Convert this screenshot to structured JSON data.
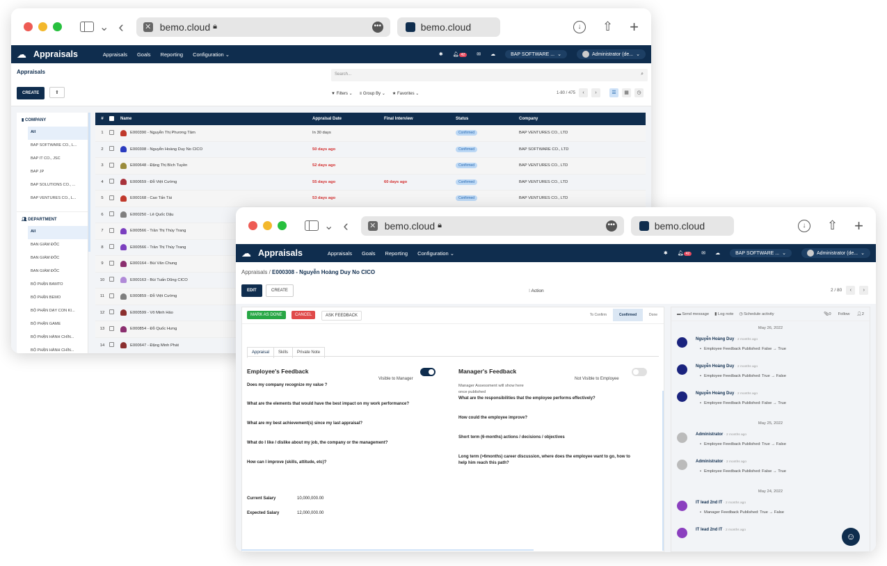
{
  "browser": {
    "url": "bemo.cloud",
    "tab_title": "bemo.cloud"
  },
  "navbar": {
    "app_title": "Appraisals",
    "menu": [
      "Appraisals",
      "Goals",
      "Reporting",
      "Configuration ⌄"
    ],
    "notification_count": "42",
    "company_switch": "BAP SOFTWARE ...",
    "user": "Administrator (de..."
  },
  "list_view": {
    "title": "Appraisals",
    "search_placeholder": "Search...",
    "create_label": "CREATE",
    "filters_label": "Filters",
    "groupby_label": "Group By",
    "favorites_label": "Favorites",
    "pager": "1-80 / 475",
    "company_header": "COMPANY",
    "companies": [
      "All",
      "BAP SOFTWARE CO., L...",
      "BAP IT CO., JSC",
      "BAP JP",
      "BAP SOLUTIONS CO., ...",
      "BAP VENTURES CO., L..."
    ],
    "department_header": "DEPARTMENT",
    "departments": [
      "All",
      "BAN GIÁM ĐỐC",
      "BAN GIÁM ĐỐC",
      "BAN GIÁM ĐỐC",
      "BỘ PHẬN BAMTO",
      "BỘ PHẬN BEMO",
      "BỘ PHẬN DẠY CON KI...",
      "BỘ PHẬN GAME",
      "BỘ PHẬN HÀNH CHÍN...",
      "BỘ PHẬN HÀNH CHÍN..."
    ],
    "columns": [
      "#",
      "Name",
      "Appraisal Date",
      "Final Interview",
      "Status",
      "Company"
    ],
    "rows": [
      {
        "n": "1",
        "name": "E000390 - Nguyễn Thị Phương Tâm",
        "date": "In 30 days",
        "date_red": false,
        "interview": "",
        "status": "Confirmed",
        "company": "BAP VENTURES CO., LTD",
        "av": "#c0392b"
      },
      {
        "n": "2",
        "name": "E000308 - Nguyễn Hoàng Duy No CICO",
        "date": "50 days ago",
        "date_red": true,
        "interview": "",
        "status": "Confirmed",
        "company": "BAP SOFTWARE CO., LTD",
        "av": "#2a3bbf"
      },
      {
        "n": "3",
        "name": "E000648 - Đặng Thị Bích Tuyền",
        "date": "52 days ago",
        "date_red": true,
        "interview": "",
        "status": "Confirmed",
        "company": "BAP VENTURES CO., LTD",
        "av": "#9a8b3b"
      },
      {
        "n": "4",
        "name": "E000659 - Đỗ Việt Cường",
        "date": "55 days ago",
        "date_red": true,
        "interview": "60 days ago",
        "status": "Confirmed",
        "company": "BAP VENTURES CO., LTD",
        "av": "#a8323b"
      },
      {
        "n": "5",
        "name": "E000168 - Cao Tấn Tài",
        "date": "53 days ago",
        "date_red": true,
        "interview": "",
        "status": "Confirmed",
        "company": "BAP VENTURES CO., LTD",
        "av": "#c0392b"
      },
      {
        "n": "6",
        "name": "E000250 - Lê Quốc Dậu",
        "date": "",
        "date_red": false,
        "interview": "",
        "status": "",
        "company": "",
        "av": "#7f7f7f"
      },
      {
        "n": "7",
        "name": "E000566 - Trần Thị Thúy Trang",
        "date": "",
        "date_red": false,
        "interview": "",
        "status": "",
        "company": "",
        "av": "#7b3fbf"
      },
      {
        "n": "8",
        "name": "E000566 - Trần Thị Thúy Trang",
        "date": "",
        "date_red": false,
        "interview": "",
        "status": "",
        "company": "",
        "av": "#7b3fbf"
      },
      {
        "n": "9",
        "name": "E000164 - Bùi Văn Chung",
        "date": "",
        "date_red": false,
        "interview": "",
        "status": "",
        "company": "",
        "av": "#8b2f6f"
      },
      {
        "n": "10",
        "name": "E000163 - Bùi Tuấn Dũng CICO",
        "date": "",
        "date_red": false,
        "interview": "",
        "status": "",
        "company": "",
        "av": "#b08ad8"
      },
      {
        "n": "11",
        "name": "E000859 - Đỗ Việt Cường",
        "date": "",
        "date_red": false,
        "interview": "",
        "status": "",
        "company": "",
        "av": "#7f7f7f"
      },
      {
        "n": "12",
        "name": "E000599 - Võ Minh Hảo",
        "date": "",
        "date_red": false,
        "interview": "",
        "status": "",
        "company": "",
        "av": "#8b2f2f"
      },
      {
        "n": "13",
        "name": "E000854 - Đỗ Quốc Hưng",
        "date": "",
        "date_red": false,
        "interview": "",
        "status": "",
        "company": "",
        "av": "#8b2f6f"
      },
      {
        "n": "14",
        "name": "E000647 - Đặng Minh Phát",
        "date": "",
        "date_red": false,
        "interview": "",
        "status": "",
        "company": "",
        "av": "#8b2f2f"
      }
    ]
  },
  "form_view": {
    "breadcrumb_parent": "Appraisals",
    "breadcrumb_current": "E000308 - Nguyễn Hoàng Duy No CICO",
    "edit_label": "EDIT",
    "create_label": "CREATE",
    "action_label": "Action",
    "pager": "2 / 80",
    "mark_done": "MARK AS DONE",
    "cancel": "CANCEL",
    "ask_feedback": "ASK FEEDBACK",
    "stages": [
      "To Confirm",
      "Confirmed",
      "Done"
    ],
    "tabs": [
      "Appraisal",
      "Skills",
      "Private Note"
    ],
    "employee_feedback": "Employee's Feedback",
    "visible_to_manager": "Visible to Manager",
    "manager_feedback": "Manager's Feedback",
    "not_visible": "Not Visible to Employee",
    "manager_note_1": "Manager Assessment will show here",
    "manager_note_2": "once published",
    "employee_questions": [
      "Does my company recognize my value ?",
      "What are the elements that would have the best impact on my work performance?",
      "What are my best achievement(s) since my last appraisal?",
      "What do I like / dislike about my job, the company or the management?",
      "How can I improve (skills, attitude, etc)?"
    ],
    "manager_questions": [
      "What are the responsibilities that the employee performs effectively?",
      "How could the employee improve?",
      "Short term (6-months) actions / decisions / objectives",
      "Long term (>6months) career discussion, where does the employee want to go, how to",
      "help him reach this path?"
    ],
    "current_salary_label": "Current Salary",
    "current_salary": "10,000,000.00",
    "expected_salary_label": "Expected Salary",
    "expected_salary": "12,000,000.00"
  },
  "chatter": {
    "send_message": "Send message",
    "log_note": "Log note",
    "schedule": "Schedule activity",
    "attachments": "0",
    "follow": "Follow",
    "followers": "2",
    "days": [
      "May 26, 2022",
      "May 25, 2022",
      "May 24, 2022"
    ],
    "messages": [
      {
        "author": "Nguyễn Hoàng Duy",
        "ago": "· 2 months ago",
        "body": "Employee Feedback Published: False → True"
      },
      {
        "author": "Nguyễn Hoàng Duy",
        "ago": "· 2 months ago",
        "body": "Employee Feedback Published: True → False"
      },
      {
        "author": "Nguyễn Hoàng Duy",
        "ago": "· 2 months ago",
        "body": "Employee Feedback Published: False → True"
      },
      {
        "author": "Administrator",
        "ago": "· 2 months ago",
        "body": "Employee Feedback Published: True → False"
      },
      {
        "author": "Administrator",
        "ago": "· 2 months ago",
        "body": "Employee Feedback Published: False → True"
      },
      {
        "author": "IT lead 2nd IT",
        "ago": "· 2 months ago",
        "body": "Manager Feedback Published: True → False"
      },
      {
        "author": "IT lead 2nd IT",
        "ago": "· 2 months ago",
        "body": ""
      }
    ]
  }
}
